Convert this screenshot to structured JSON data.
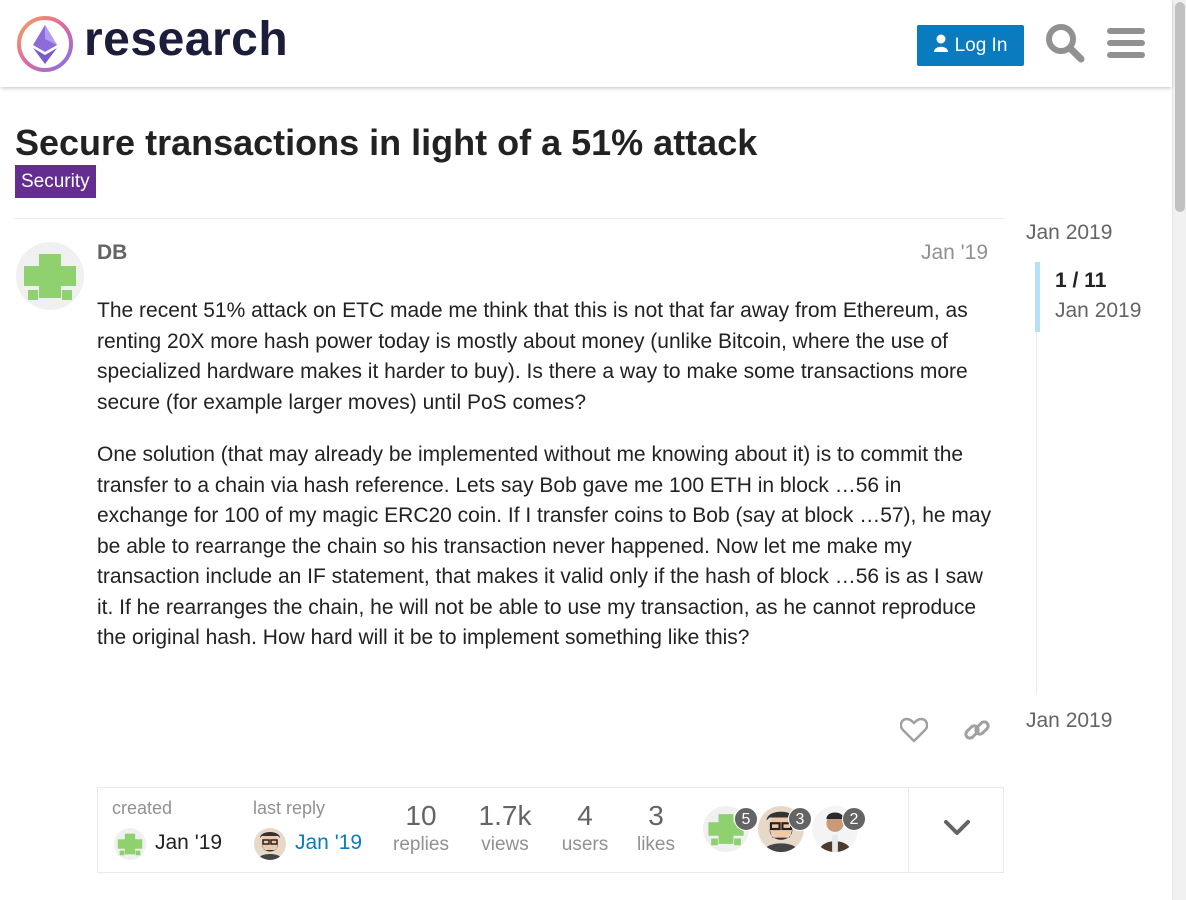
{
  "header": {
    "logo_text": "research",
    "login_label": "Log In",
    "search_icon": "search-icon",
    "menu_icon": "hamburger-menu-icon"
  },
  "topic": {
    "title": "Secure transactions in light of a 51% attack",
    "category": "Security",
    "category_color": "#652d90"
  },
  "post": {
    "username": "DB",
    "date": "Jan '19",
    "paragraphs": [
      "The recent 51% attack on ETC made me think that this is not that far away from Ethereum, as renting 20X more hash power today is mostly about money (unlike Bitcoin, where the use of specialized hardware makes it harder to buy). Is there a way to make some transactions more secure (for example larger moves) until PoS comes?",
      "One solution (that may already be implemented without me knowing about it) is to commit the transfer to a chain via hash reference. Lets say Bob gave me 100 ETH in block …56 in exchange for 100 of my magic ERC20 coin. If I transfer coins to Bob (say at block …57), he may be able to rearrange the chain so his transaction never happened. Now let me make my transaction include an IF statement, that makes it valid only if the hash of block …56 is as I saw it. If he rearranges the chain, he will not be able to use my transaction, as he cannot reproduce the original hash. How hard will it be to implement something like this?"
    ],
    "like_icon": "heart-icon",
    "share_icon": "link-icon"
  },
  "topic_map": {
    "created_label": "created",
    "created_date": "Jan '19",
    "last_reply_label": "last reply",
    "last_reply_date": "Jan '19",
    "stats": [
      {
        "num": "10",
        "label": "replies"
      },
      {
        "num": "1.7k",
        "label": "views"
      },
      {
        "num": "4",
        "label": "users"
      },
      {
        "num": "3",
        "label": "likes"
      }
    ],
    "participants": [
      {
        "count": "5"
      },
      {
        "count": "3"
      },
      {
        "count": "2"
      }
    ],
    "expand_icon": "chevron-down-icon"
  },
  "timeline": {
    "top_date": "Jan 2019",
    "position": "1 / 11",
    "position_date": "Jan 2019",
    "bottom_date": "Jan 2019"
  },
  "colors": {
    "accent": "#0a7bbf",
    "timeline_handle": "#b5e0f5",
    "avatar_green": "#8fd16f"
  }
}
